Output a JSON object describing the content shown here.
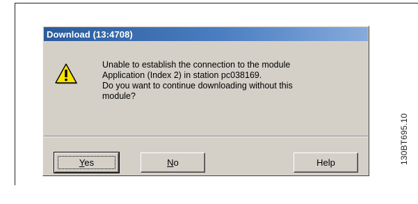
{
  "dialog": {
    "title": "Download (13:4708)",
    "icon": "warning-icon",
    "message_lines": [
      "Unable to establish the connection to the module",
      "Application (Index 2) in station pc038169.",
      "Do you want to continue downloading without this",
      "module?"
    ],
    "buttons": {
      "yes_rest": "es",
      "yes_mnemonic": "Y",
      "no_mnemonic": "N",
      "no_rest": "o",
      "help_label": "Help"
    }
  },
  "figure": {
    "reference_code": "130BT695.10"
  },
  "colors": {
    "dialog_face": "#d4d0c8",
    "title_bar_start": "#2a5b9c",
    "title_bar_end": "#86abdc",
    "warning_yellow": "#f7e300"
  }
}
